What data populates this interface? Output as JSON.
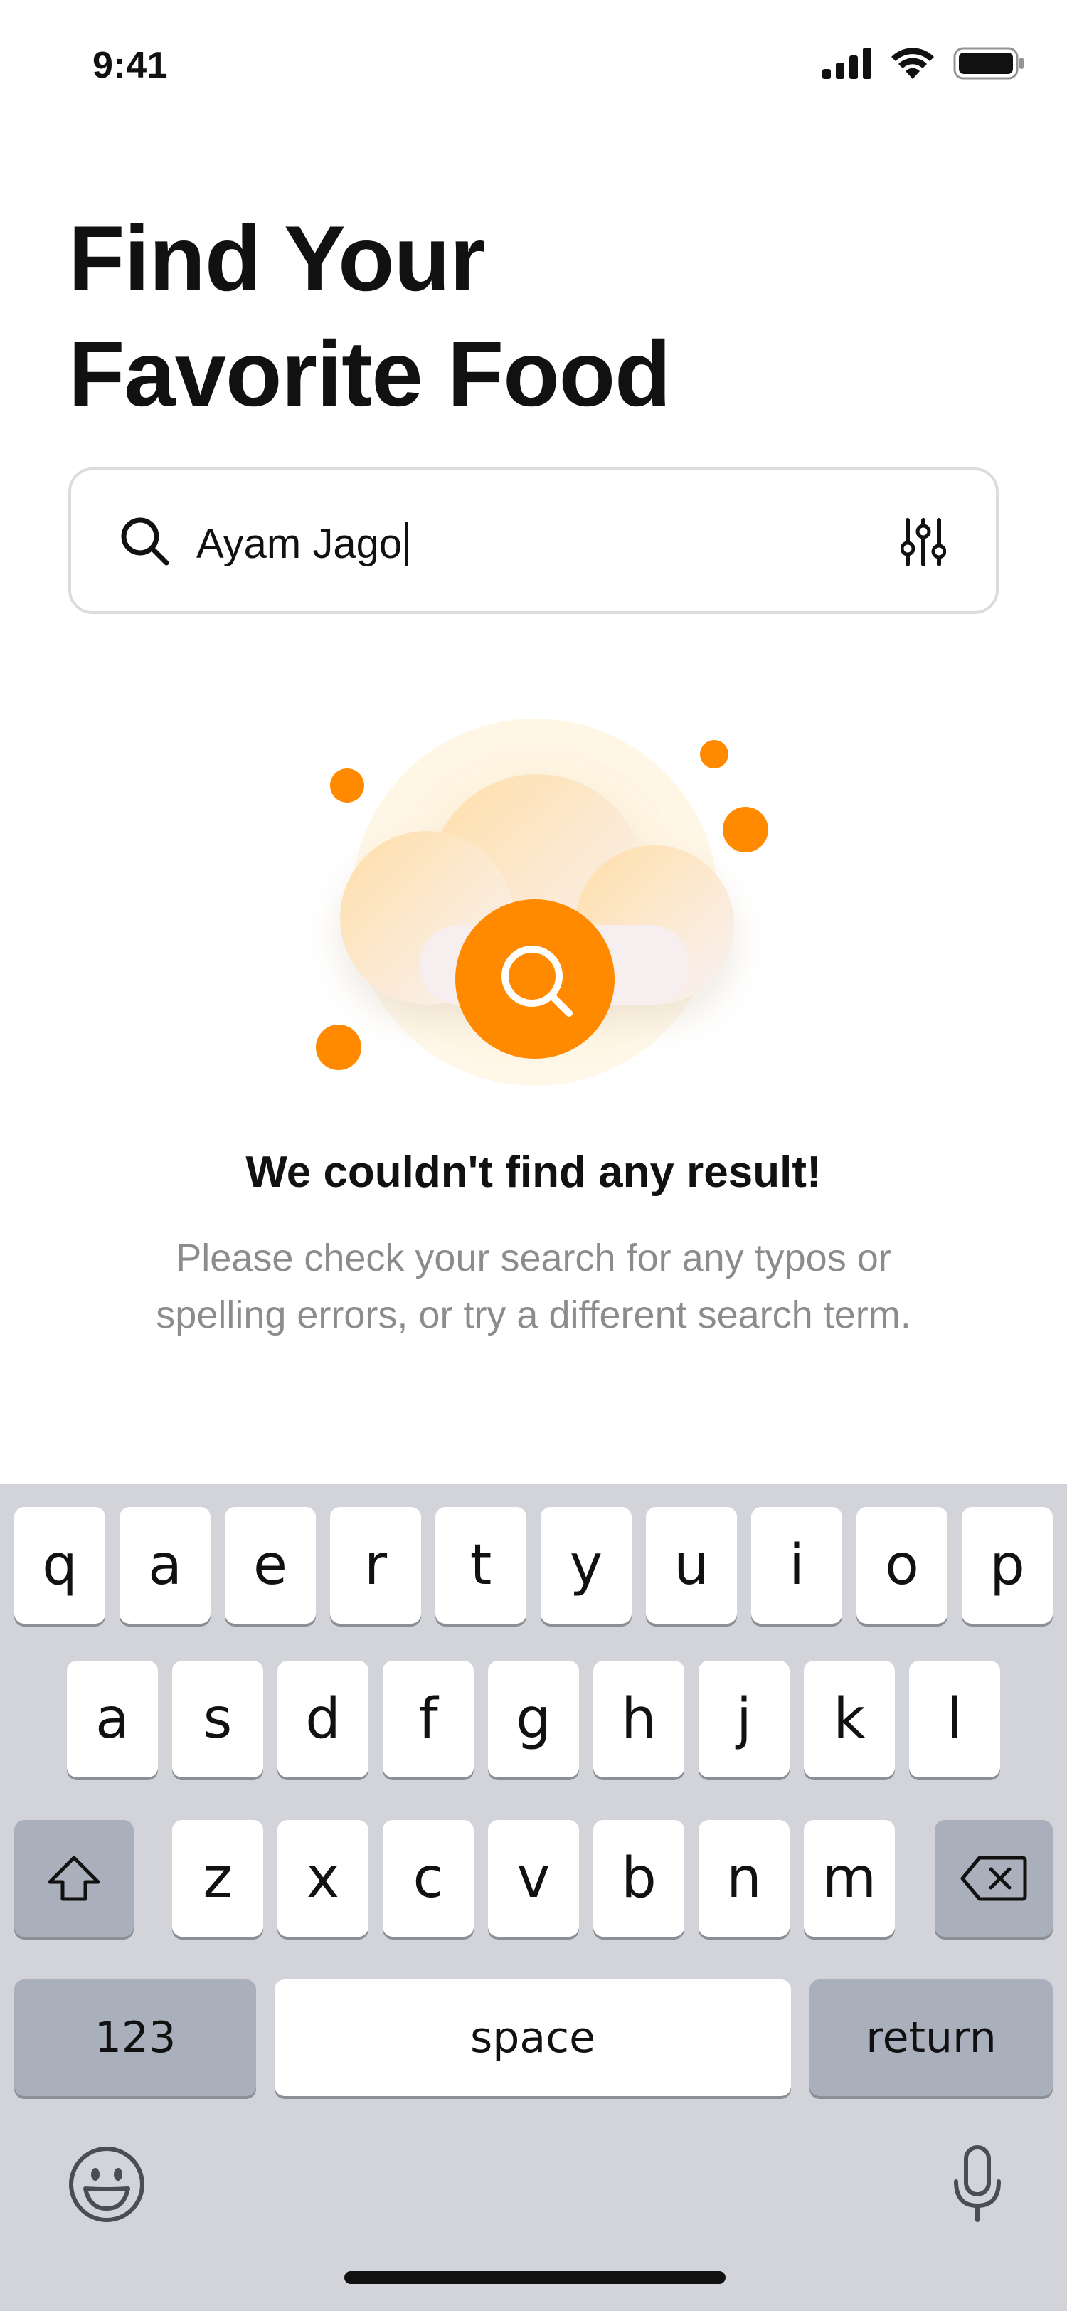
{
  "status_bar": {
    "time": "9:41"
  },
  "header": {
    "title_line1": "Find Your",
    "title_line2": "Favorite Food"
  },
  "search": {
    "value": "Ayam Jago"
  },
  "empty_state": {
    "title": "We couldn't find any result!",
    "description": "Please check your search for any typos or spelling errors, or try a different search term."
  },
  "colors": {
    "accent": "#ff8a00",
    "title": "#111111",
    "muted": "#8c8c8c",
    "keyboard_bg": "#d2d4da"
  },
  "keyboard": {
    "row1": [
      "q",
      "a",
      "e",
      "r",
      "t",
      "y",
      "u",
      "i",
      "o",
      "p"
    ],
    "row2": [
      "a",
      "s",
      "d",
      "f",
      "g",
      "h",
      "j",
      "k",
      "l"
    ],
    "row3": [
      "z",
      "x",
      "c",
      "v",
      "b",
      "n",
      "m"
    ],
    "numbers_label": "123",
    "space_label": "space",
    "return_label": "return",
    "icons": {
      "shift": "shift-icon",
      "delete": "backspace-icon",
      "emoji": "emoji-icon",
      "mic": "microphone-icon"
    }
  }
}
